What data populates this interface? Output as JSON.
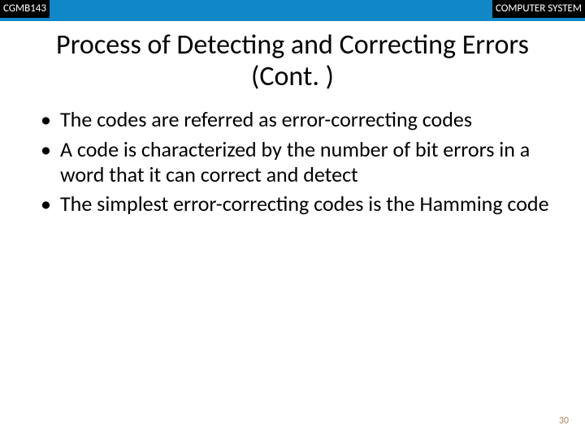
{
  "header": {
    "course_code": "CGMB143",
    "course_title": "COMPUTER SYSTEM"
  },
  "title": "Process of Detecting and Correcting Errors (Cont. )",
  "bullets": [
    "The codes are referred as error-correcting codes",
    "A code is characterized by the number of bit errors in a word that it can correct and detect",
    "The simplest error-correcting codes is the Hamming code"
  ],
  "page_number": "30"
}
